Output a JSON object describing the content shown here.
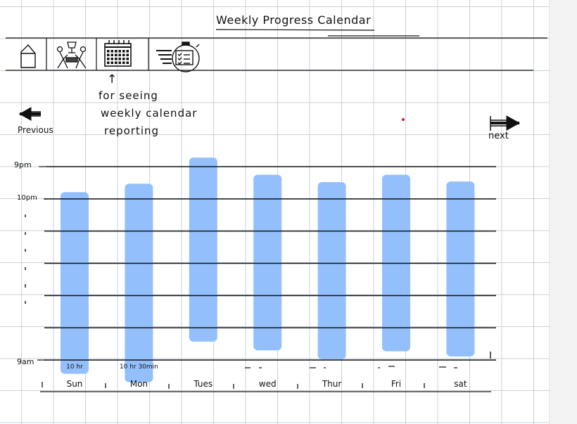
{
  "title": "Weekly Progress Calendar",
  "toolbar": {
    "items": [
      {
        "name": "home-icon"
      },
      {
        "name": "teamwork-trophy-icon"
      },
      {
        "name": "calendar-icon"
      },
      {
        "name": "fast-stopwatch-icon"
      }
    ]
  },
  "annotation": {
    "arrow": "↑",
    "lines": [
      "for seeing",
      "weekly calendar",
      "reporting"
    ]
  },
  "nav": {
    "previous_label": "Previous",
    "next_label": "next",
    "previous_icon": "left-arrow-icon",
    "next_icon": "right-arrow-icon"
  },
  "y_labels": {
    "top": "9pm",
    "second": "10pm",
    "bottom": "9am"
  },
  "bar_color": "#93c0fd",
  "chart_data": {
    "type": "bar",
    "categories": [
      "Sun",
      "Mon",
      "Tues",
      "wed",
      "Thur",
      "Fri",
      "sat"
    ],
    "duration_labels": [
      "10 hr",
      "10 hr 30min",
      "",
      "",
      "",
      "",
      ""
    ],
    "hour_lines": 7,
    "bars": [
      {
        "start": 0.79,
        "end": 6.43
      },
      {
        "start": 0.53,
        "end": 6.69
      },
      {
        "start": -0.28,
        "end": 5.43
      },
      {
        "start": 0.25,
        "end": 5.7
      },
      {
        "start": 0.48,
        "end": 5.98
      },
      {
        "start": 0.25,
        "end": 5.73
      },
      {
        "start": 0.46,
        "end": 5.89
      }
    ]
  }
}
